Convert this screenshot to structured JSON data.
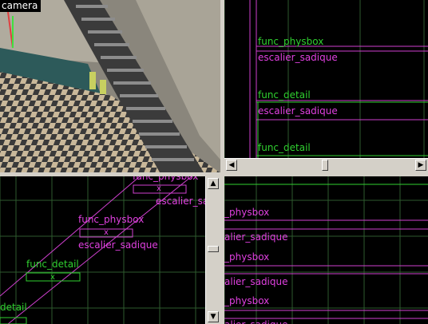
{
  "camera": {
    "label": "camera"
  },
  "top_right": {
    "labels": [
      {
        "text": "func_physbox",
        "cls": "grn"
      },
      {
        "text": "escalier_sadique",
        "cls": "mag"
      },
      {
        "text": "func_detail",
        "cls": "grn"
      },
      {
        "text": "escalier_sadique",
        "cls": "mag"
      },
      {
        "text": "func_detail",
        "cls": "grn"
      }
    ],
    "scroll_left": "◀",
    "scroll_right": "▶"
  },
  "bottom_left": {
    "labels": [
      {
        "text": "func_physbox",
        "cls": "mag"
      },
      {
        "text": "escalier_sadique",
        "cls": "mag"
      },
      {
        "text": "func_physbox",
        "cls": "mag"
      },
      {
        "text": "escalier_sadique",
        "cls": "mag"
      },
      {
        "text": "func_detail",
        "cls": "grn"
      },
      {
        "text": "detail",
        "cls": "grn"
      }
    ],
    "marker": "x",
    "scroll_up": "▲",
    "scroll_down": "▼"
  },
  "bottom_right": {
    "labels": [
      {
        "text": "_physbox",
        "cls": "mag"
      },
      {
        "text": "alier_sadique",
        "cls": "mag"
      },
      {
        "text": "_physbox",
        "cls": "mag"
      },
      {
        "text": "alier_sadique",
        "cls": "mag"
      },
      {
        "text": "_physbox",
        "cls": "mag"
      },
      {
        "text": "alier_sadique",
        "cls": "mag"
      }
    ]
  },
  "colors": {
    "grid": "#2e5a2e",
    "brush": "#d040d0",
    "selected": "#30d030"
  }
}
